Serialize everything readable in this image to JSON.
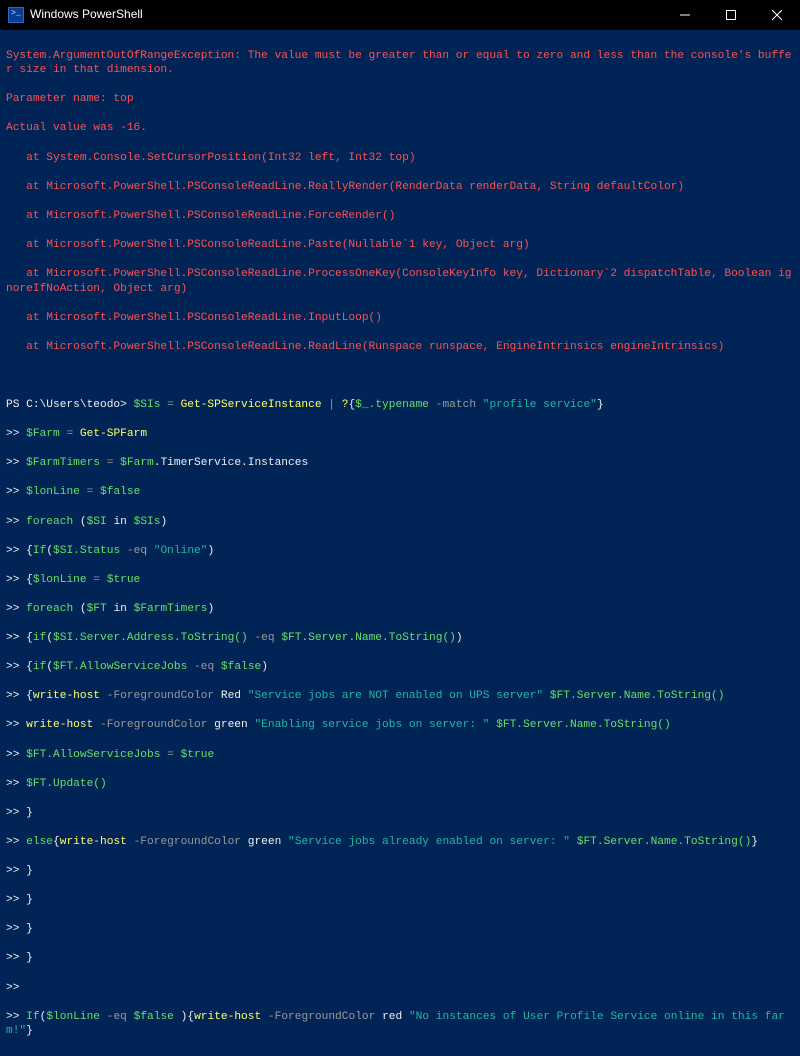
{
  "window": {
    "title": "Windows PowerShell"
  },
  "error": {
    "l1": "System.ArgumentOutOfRangeException: The value must be greater than or equal to zero and less than the console's buffer size in that dimension.",
    "l2": "Parameter name: top",
    "l3": "Actual value was -16.",
    "t1": "   at System.Console.SetCursorPosition(Int32 left, Int32 top)",
    "t2": "   at Microsoft.PowerShell.PSConsoleReadLine.ReallyRender(RenderData renderData, String defaultColor)",
    "t3": "   at Microsoft.PowerShell.PSConsoleReadLine.ForceRender()",
    "t4": "   at Microsoft.PowerShell.PSConsoleReadLine.Paste(Nullable`1 key, Object arg)",
    "t5": "   at Microsoft.PowerShell.PSConsoleReadLine.ProcessOneKey(ConsoleKeyInfo key, Dictionary`2 dispatchTable, Boolean ignoreIfNoAction, Object arg)",
    "t6": "   at Microsoft.PowerShell.PSConsoleReadLine.InputLoop()",
    "t7": "   at Microsoft.PowerShell.PSConsoleReadLine.ReadLine(Runspace runspace, EngineIntrinsics engineIntrinsics)"
  },
  "prompt": "PS C:\\Users\\teodo> ",
  "cont": ">> ",
  "tokens": {
    "sis": "$SIs",
    "eq": " = ",
    "getsp": "Get-SPServiceInstance",
    "pipe": " | ",
    "where": "?",
    "lbrace": "{",
    "rbrace": "}",
    "dtypename": "$_.typename",
    "match": " -match ",
    "profileservice": "\"profile service\"",
    "farm": "$Farm",
    "getspfarm": "Get-SPFarm",
    "farmtimers": "$FarmTimers",
    "farmTimerProp": ".TimerService.Instances",
    "lonline": "$lonLine",
    "false": "$false",
    "true": "$true",
    "foreach": "foreach",
    "lpar": " (",
    "rpar": ")",
    "si": "$SI",
    "in": " in ",
    "if": "If",
    "ifl": "if",
    "sistatus": "$SI.Status",
    "eqop": " -eq ",
    "online": "\"Online\"",
    "ft": "$FT",
    "siserver": "$SI.Server.Address.ToString()",
    "ftserver": "$FT.Server.Name.ToString()",
    "ftallow": "$FT.AllowServiceJobs",
    "writehost": "write-host",
    "fgc": " -ForegroundColor ",
    "red": "Red",
    "redl": "red",
    "green": "green",
    "msg1": "\"Service jobs are NOT enabled on UPS server\"",
    "msg2": "\"Enabling service jobs on server: \"",
    "msg3": "\"Service jobs already enabled on server: \"",
    "msg4": "\"No instances of User Profile Service online in this farm!\"",
    "ftupdate": "$FT.Update()",
    "else": "else",
    "space": " "
  }
}
